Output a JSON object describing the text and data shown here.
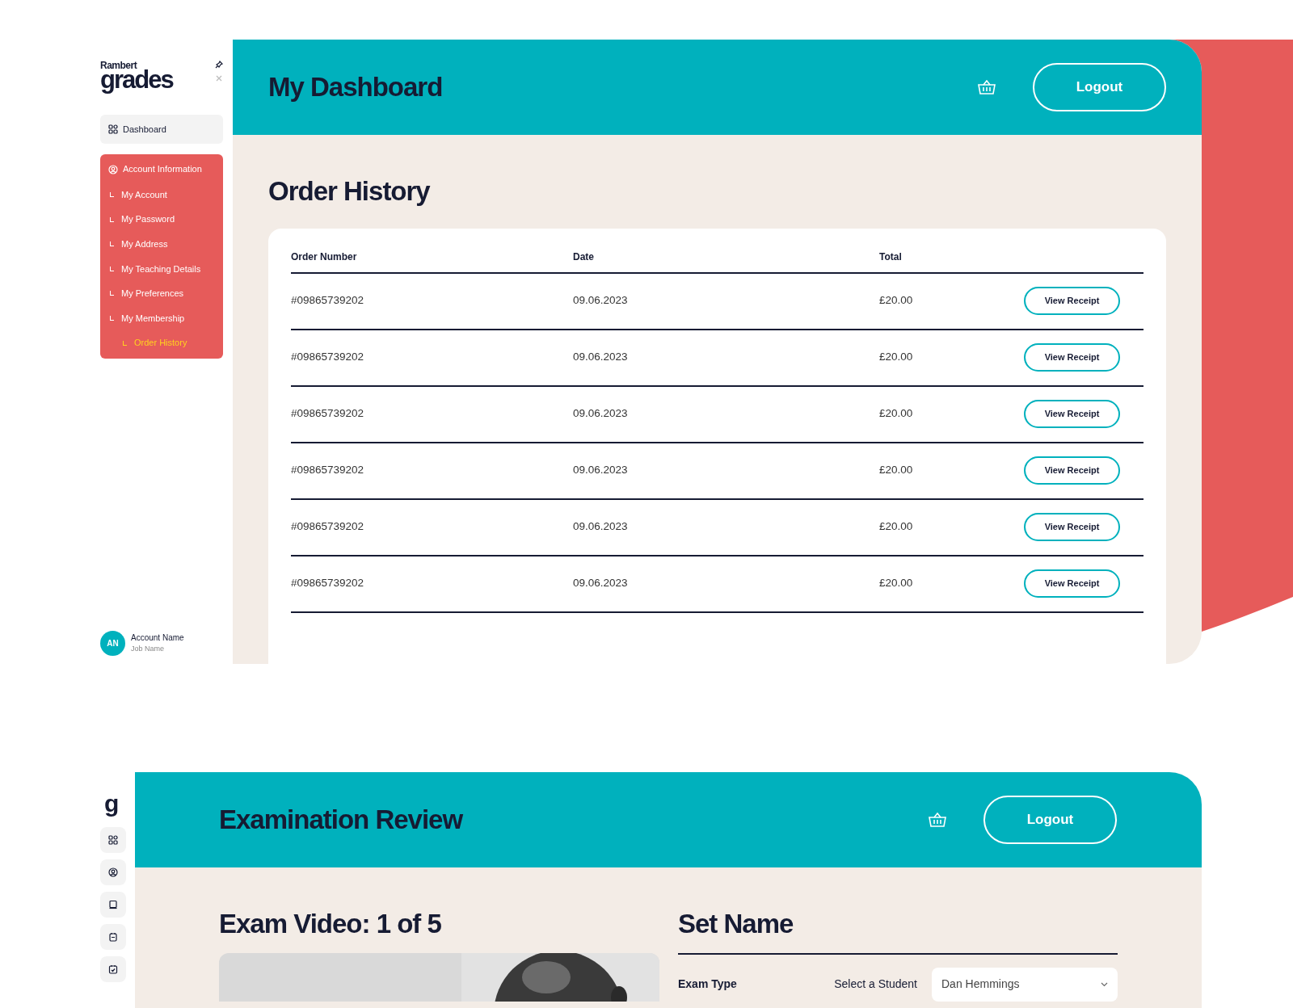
{
  "dashboard": {
    "logo": {
      "line_1": "Rambert",
      "line_2": "grades"
    },
    "nav": [
      {
        "label": "Dashboard",
        "kind": "link",
        "expanded": false
      },
      {
        "label": "Account Information",
        "kind": "group",
        "expanded": true,
        "children": [
          {
            "label": "My Account",
            "selected": false
          },
          {
            "label": "My Password",
            "selected": false
          },
          {
            "label": "My Address",
            "selected": false
          },
          {
            "label": "My Teaching Details",
            "selected": false
          },
          {
            "label": "My Preferences",
            "selected": false
          },
          {
            "label": "My Membership",
            "selected": false,
            "children": [
              {
                "label": "Order History",
                "selected": true
              }
            ]
          }
        ]
      }
    ],
    "account": {
      "initials": "AN",
      "name": "Account Name",
      "job": "Job Name"
    },
    "header": {
      "title": "My Dashboard",
      "button": "Logout"
    },
    "section_title": "Order History",
    "table": {
      "columns": [
        "Order Number",
        "Date",
        "Total"
      ],
      "rows": [
        {
          "order_number": "#09865739202",
          "date": "09.06.2023",
          "total": "£20.00",
          "action": "View Receipt"
        },
        {
          "order_number": "#09865739202",
          "date": "09.06.2023",
          "total": "£20.00",
          "action": "View Receipt"
        },
        {
          "order_number": "#09865739202",
          "date": "09.06.2023",
          "total": "£20.00",
          "action": "View Receipt"
        },
        {
          "order_number": "#09865739202",
          "date": "09.06.2023",
          "total": "£20.00",
          "action": "View Receipt"
        },
        {
          "order_number": "#09865739202",
          "date": "09.06.2023",
          "total": "£20.00",
          "action": "View Receipt"
        },
        {
          "order_number": "#09865739202",
          "date": "09.06.2023",
          "total": "£20.00",
          "action": "View Receipt"
        }
      ]
    }
  },
  "exam_review": {
    "logo": "g",
    "header": {
      "title": "Examination Review",
      "button": "Logout"
    },
    "video_title": "Exam Video: 1 of 5",
    "set_name": "Set Name",
    "exam_type_label": "Exam Type",
    "student_label": "Select a Student",
    "student_value": "Dan Hemmings"
  }
}
